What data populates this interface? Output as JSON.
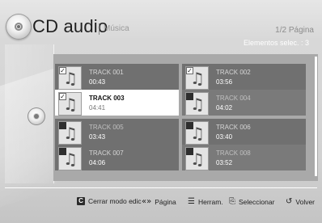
{
  "header": {
    "title": "CD audio",
    "subtitle": "Música",
    "page_info": "1/2 Página",
    "selected_info": "Elementos selec. : 3"
  },
  "tracks": [
    {
      "name": "TRACK 001",
      "time": "00:43",
      "checked": true,
      "selected": false
    },
    {
      "name": "TRACK 002",
      "time": "03:56",
      "checked": true,
      "selected": false
    },
    {
      "name": "TRACK 003",
      "time": "04:41",
      "checked": true,
      "selected": true
    },
    {
      "name": "TRACK 004",
      "time": "04:02",
      "checked": false,
      "selected": false
    },
    {
      "name": "TRACK 005",
      "time": "03:43",
      "checked": false,
      "selected": false
    },
    {
      "name": "TRACK 006",
      "time": "03:40",
      "checked": false,
      "selected": false
    },
    {
      "name": "TRACK 007",
      "time": "04:06",
      "checked": false,
      "selected": false
    },
    {
      "name": "TRACK 008",
      "time": "03:52",
      "checked": false,
      "selected": false
    }
  ],
  "footer": {
    "close_edit_key": "C",
    "close_edit_label": "Cerrar modo edic",
    "page_label": "Página",
    "tools_label": "Herram.",
    "select_label": "Seleccionar",
    "back_label": "Volver"
  },
  "icons": {
    "disc": "cd-disc-icon",
    "music_note": "music-note-icon",
    "page_arrows": "page-arrows-icon",
    "tools": "tools-icon",
    "enter": "enter-icon",
    "return": "return-icon"
  }
}
